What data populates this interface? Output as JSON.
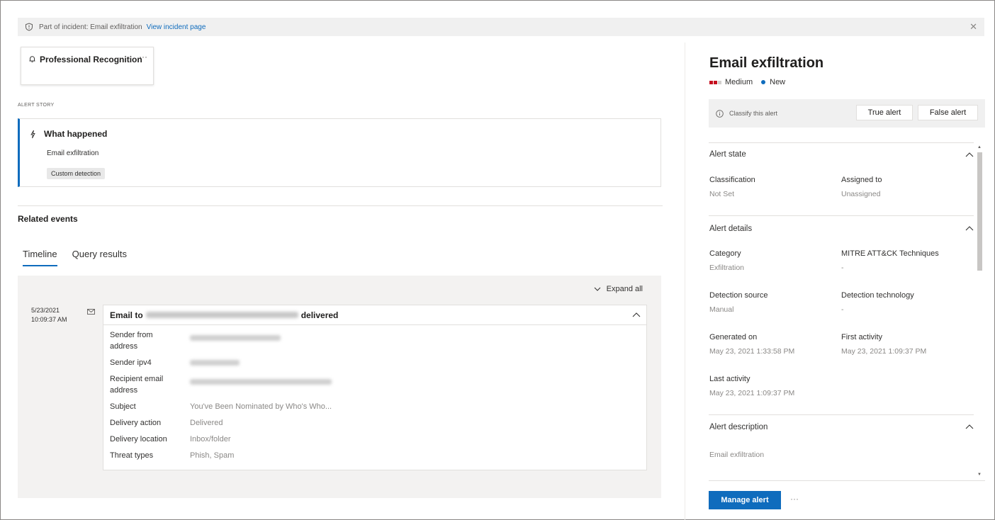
{
  "banner": {
    "prefix": "Part of incident: Email exfiltration",
    "link": "View incident page",
    "close_icon": "close-icon"
  },
  "alert_card": {
    "title": "Professional Recognition",
    "more": "···"
  },
  "alert_story": {
    "section_label": "ALERT STORY",
    "heading": "What happened",
    "description": "Email exfiltration",
    "tag": "Custom detection"
  },
  "related_events": {
    "heading": "Related events",
    "tabs": [
      {
        "label": "Timeline",
        "active": true
      },
      {
        "label": "Query results",
        "active": false
      }
    ],
    "expand_all": "Expand all",
    "event": {
      "date": "5/23/2021",
      "time": "10:09:37 AM",
      "title_prefix": "Email to",
      "title_suffix": "delivered",
      "fields": [
        {
          "key": "Sender from address",
          "value": "",
          "redacted": true
        },
        {
          "key": "Sender ipv4",
          "value": "",
          "redacted": true
        },
        {
          "key": "Recipient email address",
          "value": "",
          "redacted": true
        },
        {
          "key": "Subject",
          "value": "You've Been Nominated by Who's Who..."
        },
        {
          "key": "Delivery action",
          "value": "Delivered"
        },
        {
          "key": "Delivery location",
          "value": "Inbox/folder"
        },
        {
          "key": "Threat types",
          "value": "Phish, Spam"
        }
      ]
    }
  },
  "panel": {
    "title": "Email exfiltration",
    "severity": "Medium",
    "status": "New",
    "severity_color": "#c50f1f",
    "status_color": "#0f6cbd",
    "classify": {
      "label": "Classify this alert",
      "true_button": "True alert",
      "false_button": "False alert"
    },
    "alert_state": {
      "title": "Alert state",
      "classification_label": "Classification",
      "classification_value": "Not Set",
      "assigned_label": "Assigned to",
      "assigned_value": "Unassigned"
    },
    "alert_details": {
      "title": "Alert details",
      "category_label": "Category",
      "category_value": "Exfiltration",
      "mitre_label": "MITRE ATT&CK Techniques",
      "mitre_value": "-",
      "source_label": "Detection source",
      "source_value": "Manual",
      "technology_label": "Detection technology",
      "technology_value": "-",
      "generated_label": "Generated on",
      "generated_value": "May 23, 2021 1:33:58 PM",
      "first_label": "First activity",
      "first_value": "May 23, 2021 1:09:37 PM",
      "last_label": "Last activity",
      "last_value": "May 23, 2021 1:09:37 PM"
    },
    "alert_description": {
      "title": "Alert description",
      "value": "Email exfiltration"
    },
    "manage_button": "Manage alert",
    "more": "···"
  }
}
